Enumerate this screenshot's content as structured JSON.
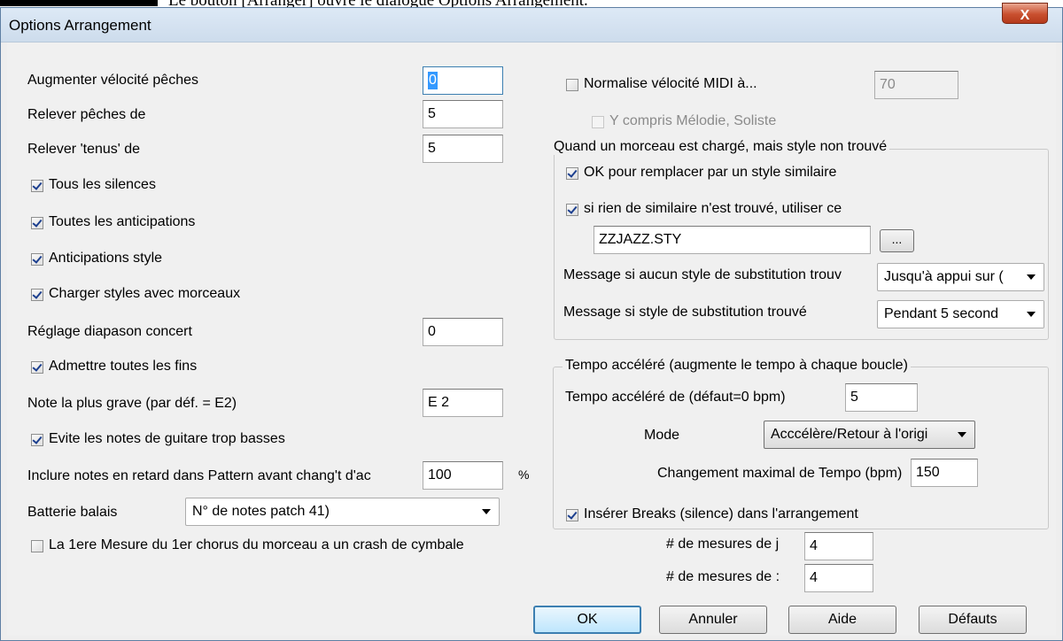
{
  "doc_caption": "Le bouton [Arranger] ouvre le dialogue Options Arrangement.",
  "dialog": {
    "title": "Options Arrangement",
    "close_label": "X"
  },
  "left": {
    "augmenter_velocite": {
      "label": "Augmenter vélocité pêches",
      "value": "0"
    },
    "relever_peches": {
      "label": "Relever pêches de",
      "value": "5"
    },
    "relever_tenus": {
      "label": "Relever 'tenus' de",
      "value": "5"
    },
    "tous_silences": {
      "label": "Tous les silences",
      "checked": true
    },
    "toutes_anticipations": {
      "label": "Toutes les anticipations",
      "checked": true
    },
    "anticipations_style": {
      "label": "Anticipations style",
      "checked": true
    },
    "charger_styles": {
      "label": "Charger styles avec morceaux",
      "checked": true
    },
    "reglage_diapason": {
      "label": "Réglage diapason concert",
      "value": "0"
    },
    "admettre_fins": {
      "label": "Admettre toutes les fins",
      "checked": true
    },
    "note_grave": {
      "label": "Note la plus grave (par déf. = E2)",
      "value": "E 2"
    },
    "evite_notes": {
      "label": "Evite les notes de guitare trop basses",
      "checked": true
    },
    "inclure_notes": {
      "label": "Inclure notes en retard dans Pattern avant chang't d'ac",
      "value": "100",
      "unit": "%"
    },
    "batterie_balais": {
      "label": "Batterie balais",
      "value": "N° de notes patch 41)"
    },
    "crash_cymbale": {
      "label": "La 1ere Mesure du 1er chorus du morceau a un crash de cymbale",
      "checked": false
    }
  },
  "right": {
    "normalise": {
      "label": "Normalise vélocité MIDI à...",
      "checked": false,
      "value": "70"
    },
    "y_compris": {
      "label": "Y compris Mélodie, Soliste",
      "checked": false
    },
    "style_group": {
      "title": "Quand un morceau est chargé, mais style non trouvé",
      "ok_remplacer": {
        "label": "OK pour remplacer par un style similaire",
        "checked": true
      },
      "si_rien": {
        "label": "si rien de similaire n'est trouvé, utiliser ce",
        "checked": true
      },
      "style_file": "ZZJAZZ.STY",
      "browse_label": "...",
      "msg_aucun": {
        "label": "Message si aucun style de substitution trouv",
        "value": "Jusqu'à appui sur ("
      },
      "msg_trouve": {
        "label": "Message si style de substitution trouvé",
        "value": "Pendant 5 second"
      }
    },
    "tempo_group": {
      "title": "Tempo accéléré (augmente le tempo à chaque boucle)",
      "tempo_accelere": {
        "label": "Tempo accéléré de (défaut=0 bpm)",
        "value": "5"
      },
      "mode": {
        "label": "Mode",
        "value": "Acccélère/Retour à l'origi"
      },
      "changement_max": {
        "label": "Changement maximal de Tempo (bpm)",
        "value": "150"
      }
    },
    "breaks": {
      "label": "Insérer Breaks (silence) dans l'arrangement",
      "checked": true,
      "mesures_1": {
        "label": "# de mesures de j",
        "value": "4"
      },
      "mesures_2": {
        "label": "# de mesures de :",
        "value": "4"
      }
    }
  },
  "buttons": {
    "ok": "OK",
    "annuler": "Annuler",
    "aide": "Aide",
    "defauts": "Défauts"
  }
}
